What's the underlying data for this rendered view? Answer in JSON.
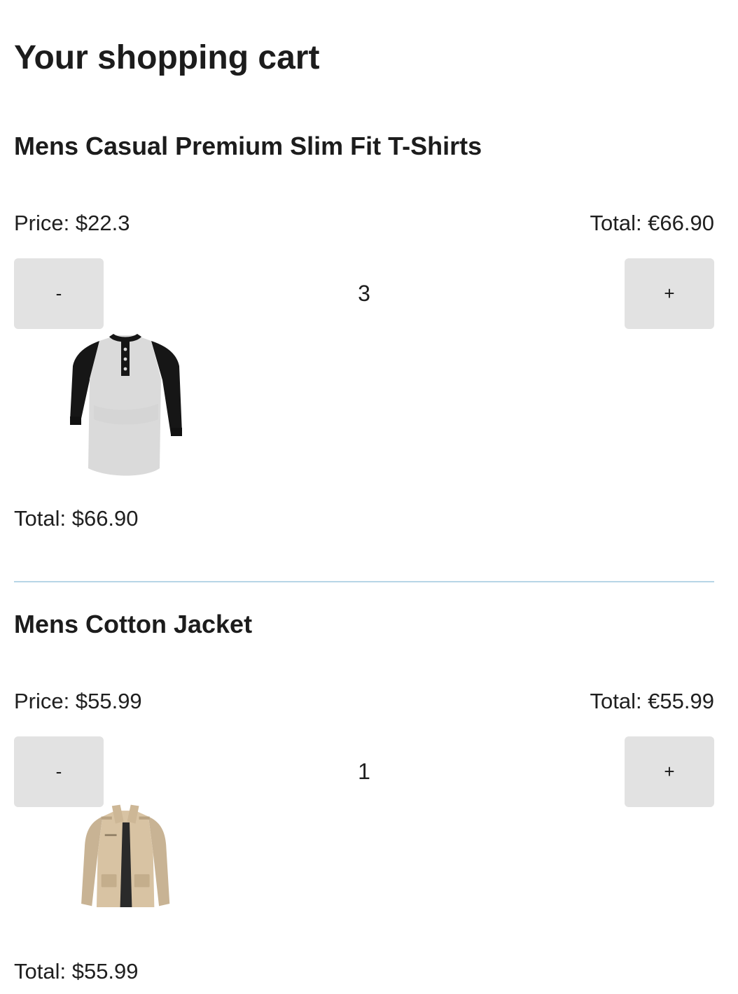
{
  "page": {
    "title": "Your shopping cart"
  },
  "cart": {
    "items": [
      {
        "name": "Mens Casual Premium Slim Fit T-Shirts",
        "price_label": "Price: $22.3",
        "total_right_label": "Total: €66.90",
        "decrement_label": "-",
        "quantity": "3",
        "increment_label": "+",
        "image_name": "tshirt-image",
        "total_label": "Total: $66.90"
      },
      {
        "name": "Mens Cotton Jacket",
        "price_label": "Price: $55.99",
        "total_right_label": "Total: €55.99",
        "decrement_label": "-",
        "quantity": "1",
        "increment_label": "+",
        "image_name": "jacket-image",
        "total_label": "Total: $55.99"
      }
    ]
  },
  "colors": {
    "text": "#1c1c1c",
    "button_bg": "#e2e2e2",
    "divider": "#b7d5e6",
    "background": "#ffffff"
  }
}
